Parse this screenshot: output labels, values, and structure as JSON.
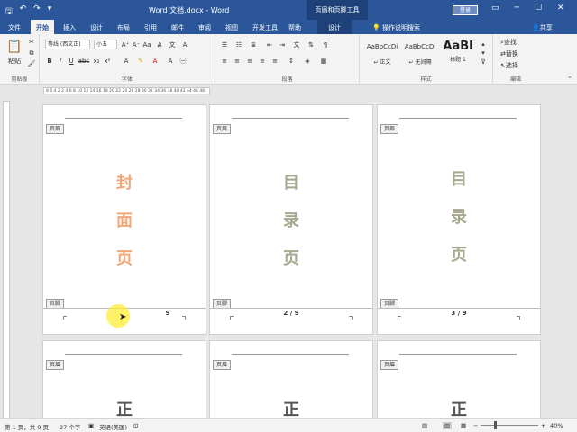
{
  "window": {
    "title": "Word 文档.docx - Word",
    "context_title": "页眉和页脚工具",
    "login": "登录",
    "save_icon": "save-icon",
    "undo_icon": "undo-icon",
    "redo_icon": "redo-icon",
    "accent": "#2b579a"
  },
  "tabs": [
    {
      "label": "文件"
    },
    {
      "label": "开始"
    },
    {
      "label": "插入"
    },
    {
      "label": "设计"
    },
    {
      "label": "布局"
    },
    {
      "label": "引用"
    },
    {
      "label": "邮件"
    },
    {
      "label": "审阅"
    },
    {
      "label": "视图"
    },
    {
      "label": "开发工具"
    },
    {
      "label": "帮助"
    },
    {
      "label": "设计"
    }
  ],
  "tellme": "操作说明搜索",
  "share": "共享",
  "ribbon": {
    "clipboard": {
      "paste": "粘贴",
      "label": "剪贴板"
    },
    "font": {
      "name": "等线 (西文正)",
      "size": "小五",
      "label": "字体"
    },
    "paragraph": {
      "label": "段落"
    },
    "styles": {
      "label": "样式",
      "items": [
        {
          "preview": "AaBbCcDi",
          "name": "↵ 正文"
        },
        {
          "preview": "AaBbCcDi",
          "name": "↵ 无间隔"
        },
        {
          "preview": "AaBl",
          "name": "标题 1"
        }
      ]
    },
    "editing": {
      "find": "查找",
      "replace": "替换",
      "select": "选择",
      "label": "编辑"
    }
  },
  "ruler_text": "8 6 4 2   2 4 6 8 10 12 14 16 18 20 22 24 26 28 30 32 34 36 38 40 42 44 46 48",
  "header_tag": "页眉",
  "footer_tag": "页脚",
  "pages": [
    {
      "chars": [
        "封",
        "面",
        "页"
      ],
      "color": "#f0a878",
      "page_num": "9"
    },
    {
      "chars": [
        "目",
        "录",
        "页"
      ],
      "color": "#a8a890",
      "page_num": "2 / 9"
    },
    {
      "chars": [
        "目",
        "录",
        "页"
      ],
      "color": "#a8a890",
      "page_num": "3 / 9"
    }
  ],
  "pages_row2": [
    {
      "char": "正"
    },
    {
      "char": "正"
    },
    {
      "char": "正"
    }
  ],
  "status": {
    "page": "第 1 页，共 9 页",
    "words": "27 个字",
    "lang": "英语(美国)",
    "zoom": "40%"
  }
}
